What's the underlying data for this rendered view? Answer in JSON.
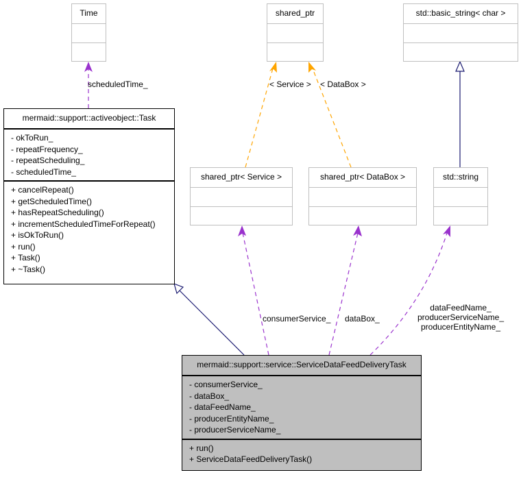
{
  "colors": {
    "inheritance": "#191970",
    "usage": "#9a32cd",
    "template": "#ffa500",
    "focus_fill": "#bfbfbf",
    "box_border": "#bfbfbf"
  },
  "classes": {
    "time": {
      "name": "Time"
    },
    "shared_ptr": {
      "name": "shared_ptr"
    },
    "basic_string": {
      "name": "std::basic_string< char >"
    },
    "task": {
      "name": "mermaid::support::activeobject::Task",
      "attributes": [
        "- okToRun_",
        "- repeatFrequency_",
        "- repeatScheduling_",
        "- scheduledTime_"
      ],
      "methods": [
        "+ cancelRepeat()",
        "+ getScheduledTime()",
        "+ hasRepeatScheduling()",
        "+ incrementScheduledTimeForRepeat()",
        "+ isOkToRun()",
        "+ run()",
        "+ Task()",
        "+ ~Task()"
      ]
    },
    "shared_ptr_service": {
      "name": "shared_ptr< Service >"
    },
    "shared_ptr_databox": {
      "name": "shared_ptr< DataBox >"
    },
    "std_string": {
      "name": "std::string"
    },
    "delivery_task": {
      "name": "mermaid::support::service::ServiceDataFeedDeliveryTask",
      "attributes": [
        "- consumerService_",
        "- dataBox_",
        "- dataFeedName_",
        "- producerEntityName_",
        "- producerServiceName_"
      ],
      "methods": [
        "+ run()",
        "+ ServiceDataFeedDeliveryTask()"
      ]
    }
  },
  "edge_labels": {
    "scheduled_time": "scheduledTime_",
    "tmpl_service": "< Service >",
    "tmpl_databox": "< DataBox >",
    "consumer_service": "consumerService_",
    "data_box": "dataBox_",
    "string_members": [
      "dataFeedName_",
      "producerServiceName_",
      "producerEntityName_"
    ]
  }
}
